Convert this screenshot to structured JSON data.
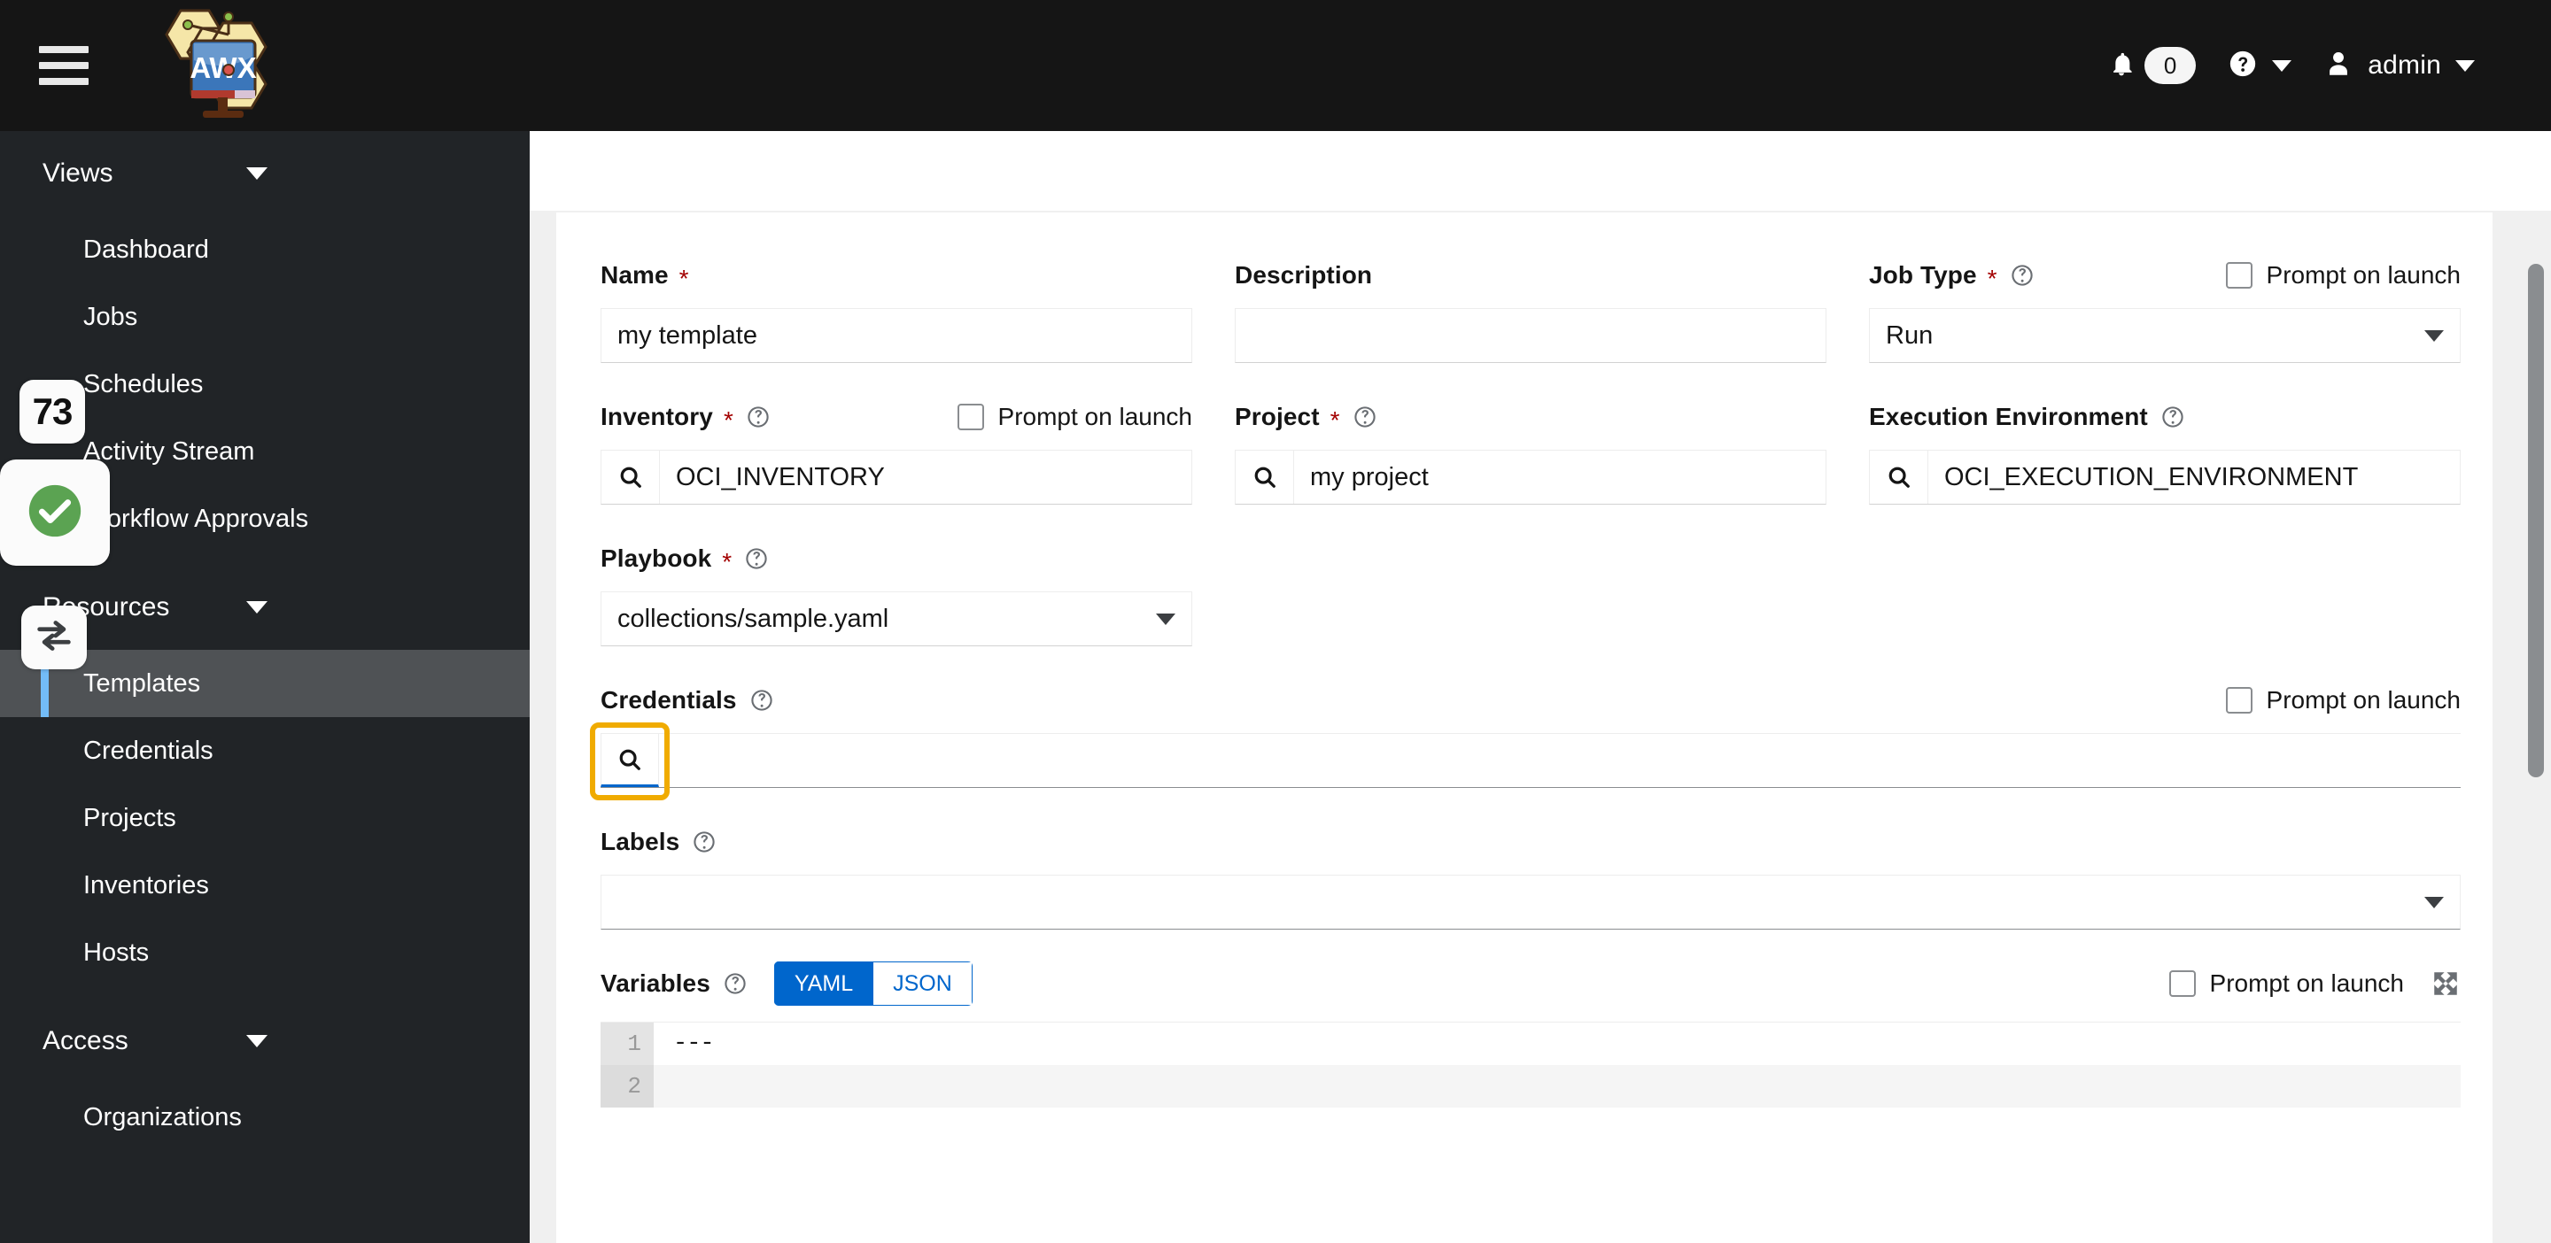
{
  "masthead": {
    "menu_icon": "hamburger-icon",
    "logo_text": "AWX",
    "bell_icon": "bell-icon",
    "notification_count": "0",
    "help_icon": "question-circle-icon",
    "help_caret": "chevron-down-icon",
    "user_icon": "user-icon",
    "user_name": "admin",
    "user_caret": "chevron-down-icon"
  },
  "sidebar": {
    "groups": [
      {
        "label": "Views",
        "items": [
          "Dashboard",
          "Jobs",
          "Schedules",
          "Activity Stream",
          "Workflow Approvals"
        ]
      },
      {
        "label": "Resources",
        "items": [
          "Templates",
          "Credentials",
          "Projects",
          "Inventories",
          "Hosts"
        ]
      },
      {
        "label": "Access",
        "items": [
          "Organizations"
        ]
      }
    ],
    "active_item": "Templates"
  },
  "overlay_chips": {
    "counter": "73",
    "check_icon": "green-check-circle-icon",
    "swap_icon": "swap-arrows-icon"
  },
  "form": {
    "name": {
      "label": "Name",
      "required": "*",
      "value": "my template"
    },
    "description": {
      "label": "Description",
      "value": ""
    },
    "job_type": {
      "label": "Job Type",
      "required": "*",
      "help_icon": "question-circle-icon",
      "value": "Run",
      "prompt_label": "Prompt on launch",
      "prompt_checked": false
    },
    "inventory": {
      "label": "Inventory",
      "required": "*",
      "help_icon": "question-circle-icon",
      "search_icon": "search-icon",
      "value": "OCI_INVENTORY",
      "prompt_label": "Prompt on launch",
      "prompt_checked": false
    },
    "project": {
      "label": "Project",
      "required": "*",
      "help_icon": "question-circle-icon",
      "search_icon": "search-icon",
      "value": "my project"
    },
    "execution_environment": {
      "label": "Execution Environment",
      "help_icon": "question-circle-icon",
      "search_icon": "search-icon",
      "value": "OCI_EXECUTION_ENVIRONMENT"
    },
    "playbook": {
      "label": "Playbook",
      "required": "*",
      "help_icon": "question-circle-icon",
      "value": "collections/sample.yaml"
    },
    "credentials": {
      "label": "Credentials",
      "help_icon": "question-circle-icon",
      "search_icon": "search-icon",
      "value": "",
      "prompt_label": "Prompt on launch",
      "prompt_checked": false,
      "focused": true,
      "focus_ring_color": "#f0ab00"
    },
    "labels": {
      "label": "Labels",
      "help_icon": "question-circle-icon",
      "value": "",
      "caret_icon": "chevron-down-icon"
    },
    "variables": {
      "label": "Variables",
      "help_icon": "question-circle-icon",
      "toggle_yaml": "YAML",
      "toggle_json": "JSON",
      "selected_format": "YAML",
      "prompt_label": "Prompt on launch",
      "prompt_checked": false,
      "expand_icon": "expand-arrows-icon",
      "lines": [
        "---",
        ""
      ],
      "line_numbers": [
        "1",
        "2"
      ]
    }
  },
  "colors": {
    "masthead_bg": "#151515",
    "sidebar_bg": "#212427",
    "active_nav_bg": "#4f5255",
    "active_nav_accent": "#73bcf7",
    "page_bg": "#f0f0f0",
    "card_bg": "#ffffff",
    "primary_blue": "#0066cc",
    "required_red": "#a30000",
    "focus_orange": "#f0ab00",
    "success_green": "#5ba352"
  }
}
